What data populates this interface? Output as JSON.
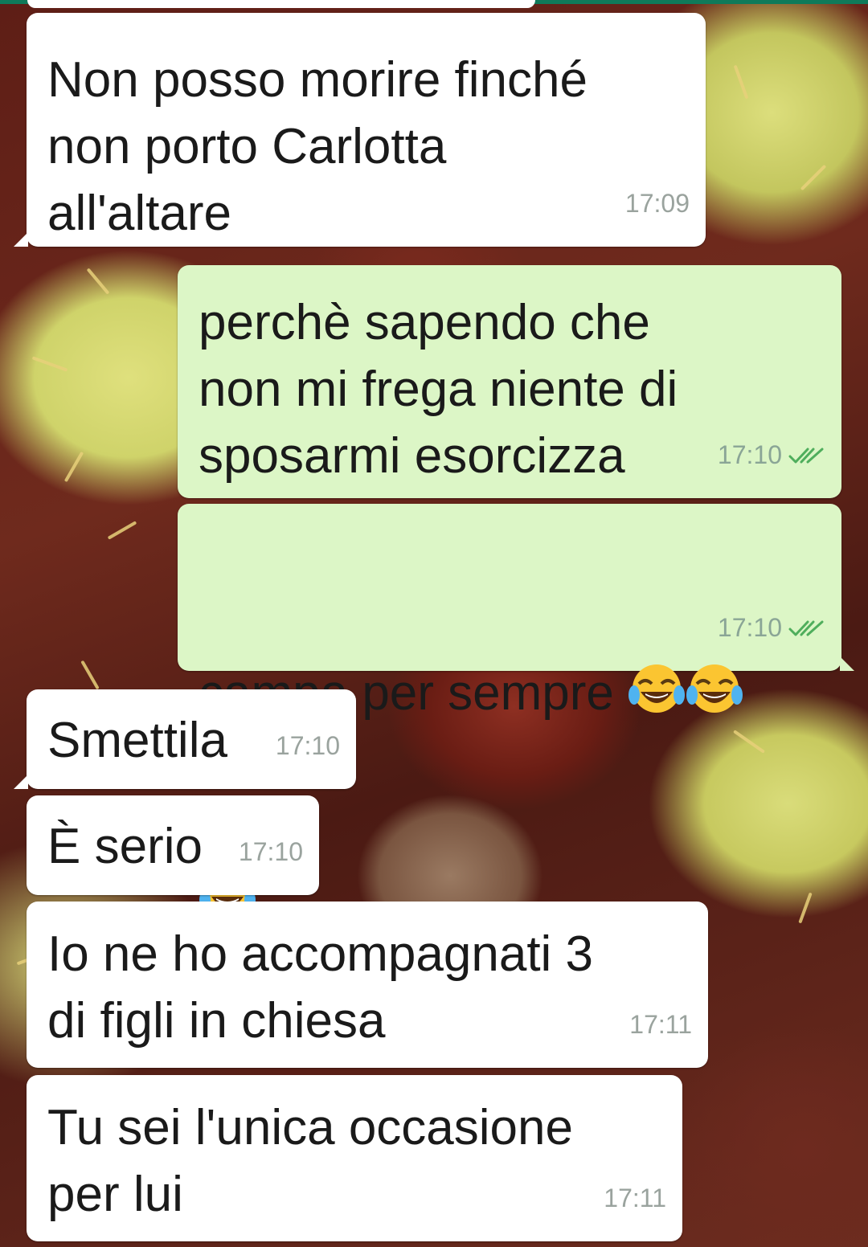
{
  "colors": {
    "incoming_bubble": "#ffffff",
    "outgoing_bubble": "#dcf6c6",
    "timestamp": "#9aa39e",
    "read_ticks": "#34b7f1",
    "sent_ticks_green": "#4fae5c",
    "header_strip": "#0f7a5a"
  },
  "messages": [
    {
      "direction": "in",
      "text_lines": [
        "Non posso morire finché",
        "non porto Carlotta",
        "all'altare"
      ],
      "time": "17:09"
    },
    {
      "direction": "out",
      "text_lines": [
        "perchè sapendo che",
        "non mi frega niente di",
        "sposarmi esorcizza"
      ],
      "time": "17:10",
      "status_icon": "double-check-icon"
    },
    {
      "direction": "out",
      "text_lines": [
        "campa per sempre"
      ],
      "emojis": [
        "face-with-tears-of-joy",
        "face-with-tears-of-joy",
        "face-with-tears-of-joy"
      ],
      "time": "17:10",
      "status_icon": "double-check-icon"
    },
    {
      "direction": "in",
      "text_lines": [
        "Smettila"
      ],
      "time": "17:10"
    },
    {
      "direction": "in",
      "text_lines": [
        "È serio"
      ],
      "time": "17:10"
    },
    {
      "direction": "in",
      "text_lines": [
        "Io ne ho accompagnati 3",
        "di figli in chiesa"
      ],
      "time": "17:11"
    },
    {
      "direction": "in",
      "text_lines": [
        "Tu sei l'unica occasione",
        "per lui"
      ],
      "time": "17:11"
    }
  ]
}
